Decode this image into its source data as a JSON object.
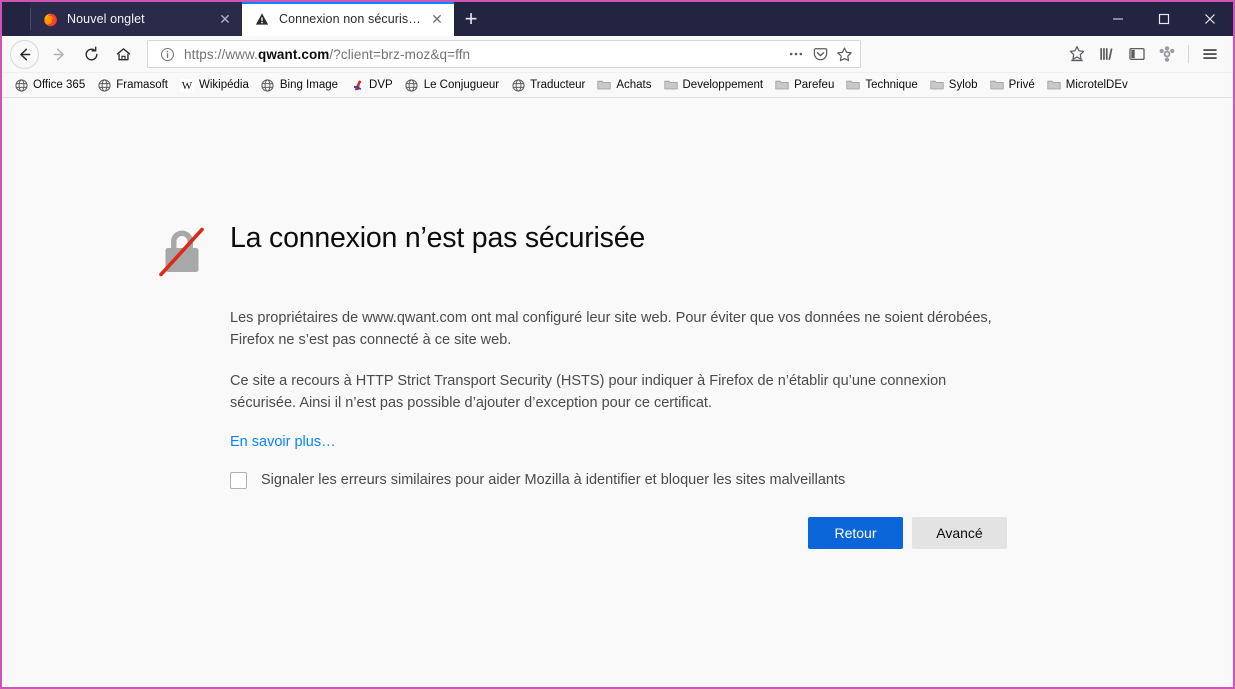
{
  "window": {
    "controls": [
      {
        "name": "minimize-button",
        "glyph": "—"
      },
      {
        "name": "maximize-button",
        "glyph": "□"
      },
      {
        "name": "close-button",
        "glyph": "✕"
      }
    ]
  },
  "tabs": [
    {
      "title": "Nouvel onglet",
      "favicon": "firefox-logo-icon",
      "active": false,
      "close_glyph": "✕"
    },
    {
      "title": "Connexion non sécurisée",
      "favicon": "warning-triangle-icon",
      "active": true,
      "close_glyph": "✕"
    }
  ],
  "newtab_label": "+",
  "navigation": {
    "back_label": "←",
    "forward_label": "→",
    "reload_label": "↻",
    "home_label": "⌂"
  },
  "urlbar": {
    "identity_icon": "info-circle-icon",
    "scheme": "https://www.",
    "domain": "qwant.com",
    "path": "/?client=brz-moz&q=ffn",
    "full_url": "https://www.qwant.com/?client=brz-moz&q=ffn",
    "page_actions_label": "•••",
    "pocket_label": "pocket-icon",
    "bookmark_star_label": "bookmark-star-icon"
  },
  "toolbar_right": [
    {
      "name": "save-to-pocket-icon"
    },
    {
      "name": "library-icon"
    },
    {
      "name": "sidebar-icon"
    },
    {
      "name": "avast-extension-icon"
    },
    {
      "name": "app-menu-icon"
    }
  ],
  "bookmarks": [
    {
      "label": "Office 365",
      "icon": "globe-icon"
    },
    {
      "label": "Framasoft",
      "icon": "globe-icon"
    },
    {
      "label": "Wikipédia",
      "icon": "wikipedia-w-icon"
    },
    {
      "label": "Bing Image",
      "icon": "globe-icon"
    },
    {
      "label": "DVP",
      "icon": "developpez-icon"
    },
    {
      "label": "Le Conjugueur",
      "icon": "globe-icon"
    },
    {
      "label": "Traducteur",
      "icon": "globe-icon"
    },
    {
      "label": "Achats",
      "icon": "folder-icon"
    },
    {
      "label": "Developpement",
      "icon": "folder-icon"
    },
    {
      "label": "Parefeu",
      "icon": "folder-icon"
    },
    {
      "label": "Technique",
      "icon": "folder-icon"
    },
    {
      "label": "Sylob",
      "icon": "folder-icon"
    },
    {
      "label": "Privé",
      "icon": "folder-icon"
    },
    {
      "label": "MicrotelDEv",
      "icon": "folder-icon"
    }
  ],
  "error_page": {
    "icon": "broken-lock-icon",
    "title": "La connexion n’est pas sécurisée",
    "paragraph1": "Les propriétaires de www.qwant.com ont mal configuré leur site web. Pour éviter que vos données ne soient dérobées, Firefox ne s’est pas connecté à ce site web.",
    "paragraph2": "Ce site a recours à HTTP Strict Transport Security (HSTS) pour indiquer à Firefox de n’établir qu’une connexion sécurisée. Ainsi il n’est pas possible d’ajouter d’exception pour ce certificat.",
    "learn_more": "En savoir plus…",
    "checkbox_label": "Signaler les erreurs similaires pour aider Mozilla à identifier et bloquer les sites malveillants",
    "checkbox_checked": false,
    "primary_button": "Retour",
    "secondary_button": "Avancé"
  },
  "colors": {
    "accent_blue": "#0a65d8",
    "link_blue": "#0a84ff",
    "chrome_dark": "#232342",
    "window_border": "#cc55b5",
    "content_bg": "#f9f9fa"
  }
}
